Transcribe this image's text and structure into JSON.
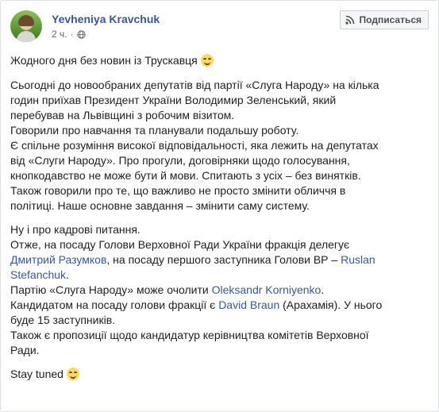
{
  "post": {
    "author": "Yevheniya Kravchuk",
    "time": "2 ч.",
    "subscribe_label": "Подписаться",
    "icons": {
      "subscribe": "rss-icon",
      "audience": "globe-icon",
      "emoji": "smiling-face-icon"
    },
    "title_line": "Жодного дня без новин із Трускавця",
    "p1": {
      "l1": "Сьогодні до новообраних депутатів від партії «Слуга Народу» на кілька",
      "l2": "годин приїхав Президент України Володимир Зеленський, який",
      "l3": "перебував на Львівщині з робочим візитом.",
      "l4": "Говорили про навчання та планували подальшу роботу.",
      "l5": "Є спільне розуміння високої відповідальності, яка лежить на депутатах",
      "l6": "від «Слуги Народу». Про прогули, договірняки щодо голосування,",
      "l7": "кнопкодавство не може бути й мови. Спитають з усіх – без винятків.",
      "l8": "Також говорили про те, що важливо не просто змінити обличчя в",
      "l9": "політиці. Наше основне завдання – змінити саму систему."
    },
    "p2": {
      "l1": "Ну і про кадрові питання.",
      "l2": "Отже, на посаду Голови Верховної Ради України фракція делегує",
      "l3_link": "Дмитрий Разумков",
      "l3_text": ", на посаду першого заступника Голови ВР – ",
      "l3_link2": "Ruslan",
      "l4_link2": "Stefanchuk",
      "l4_text": ".",
      "l5_text": "Партію «Слуга Народу» може очолити ",
      "l5_link": "Oleksandr Korniyenko",
      "l5_end": ".",
      "l6_text": "Кандидатом на посаду голови фракції є ",
      "l6_link": "David Braun",
      "l6_end": " (Арахамія). У нього",
      "l7": "буде 15 заступників.",
      "l8": "Також є пропозиції щодо кандидатур керівництва комітетів Верховної",
      "l9": "Ради."
    },
    "closing": "Stay tuned"
  }
}
